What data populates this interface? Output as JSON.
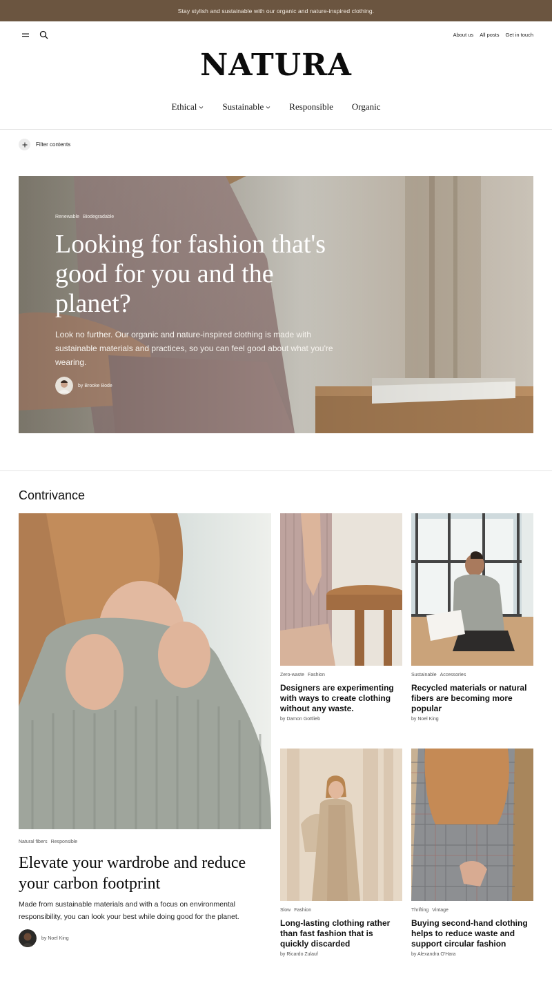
{
  "announcement": "Stay stylish and sustainable with our organic and nature-inspired clothing.",
  "header": {
    "links": [
      "About us",
      "All posts",
      "Get in touch"
    ],
    "logo": "NATURA",
    "icons": {
      "menu": "menu-icon",
      "search": "search-icon"
    }
  },
  "nav": {
    "items": [
      {
        "label": "Ethical",
        "has_dropdown": true
      },
      {
        "label": "Sustainable",
        "has_dropdown": true
      },
      {
        "label": "Responsible",
        "has_dropdown": false
      },
      {
        "label": "Organic",
        "has_dropdown": false
      }
    ]
  },
  "filter": {
    "label": "Filter contents",
    "icon": "plus-icon"
  },
  "hero": {
    "tags": [
      "Renewable",
      "Biodegradable"
    ],
    "title": "Looking for fashion that's good for you and the planet?",
    "description": "Look no further. Our organic and nature-inspired clothing is made with sustainable materials and practices, so you can feel good about what you're wearing.",
    "author": "by Brooke Bode"
  },
  "section": {
    "title": "Contrivance",
    "featured": {
      "tags": [
        "Natural fibers",
        "Responsible"
      ],
      "title": "Elevate your wardrobe and reduce your carbon footprint",
      "description": "Made from sustainable materials and with a focus on environmental responsibility, you can look your best while doing good for the planet.",
      "author": "by Noel King"
    },
    "cards": [
      {
        "tags": [
          "Zero-waste",
          "Fashion"
        ],
        "title": "Designers are experimenting with ways to create clothing without any waste.",
        "author": "by Damon Gottlieb"
      },
      {
        "tags": [
          "Sustainable",
          "Accessories"
        ],
        "title": "Recycled materials or natural fibers are becoming more popular",
        "author": "by Noel King"
      },
      {
        "tags": [
          "Slow",
          "Fashion"
        ],
        "title": "Long-lasting clothing rather than fast fashion that is quickly discarded",
        "author": "by Ricardo Zulauf"
      },
      {
        "tags": [
          "Thrifting",
          "Vintage"
        ],
        "title": "Buying second-hand clothing helps to reduce waste and support circular fashion",
        "author": "by Alexandra O'Hara"
      }
    ]
  },
  "colors": {
    "announcement_bg": "#6b5540",
    "announcement_text": "#f4ede4",
    "divider": "#e3e3e3"
  }
}
